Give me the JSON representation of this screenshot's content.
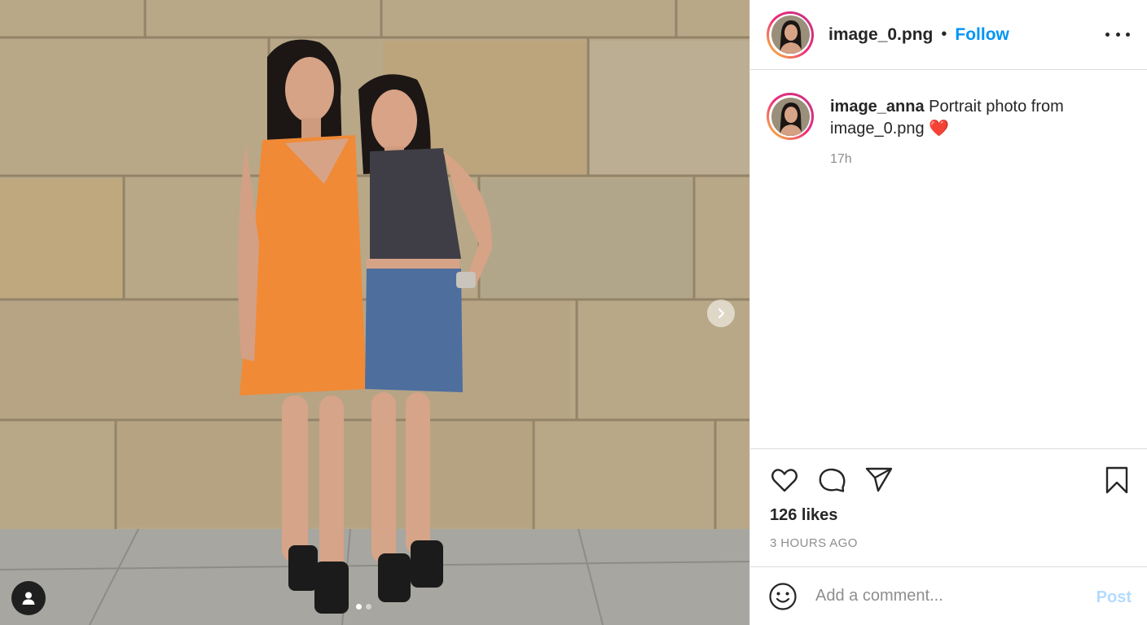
{
  "post": {
    "username": "image_0.png",
    "separator": "•",
    "follow_label": "Follow",
    "more_icon": "more-horizontal-icon"
  },
  "caption": {
    "username": "image_anna",
    "text": "Portrait photo from image_0.png",
    "emoji": "❤️",
    "time": "17h"
  },
  "stats": {
    "likes": "126 likes",
    "posted": "3 HOURS AGO"
  },
  "comment": {
    "placeholder": "Add a comment...",
    "post_label": "Post"
  },
  "carousel": {
    "slide_count": 2,
    "active_index": 0
  },
  "colors": {
    "accent": "#0095f6",
    "post_disabled": "#b3dbff",
    "text": "#262626",
    "secondary": "#8e8e8e",
    "border": "#dbdbdb"
  }
}
